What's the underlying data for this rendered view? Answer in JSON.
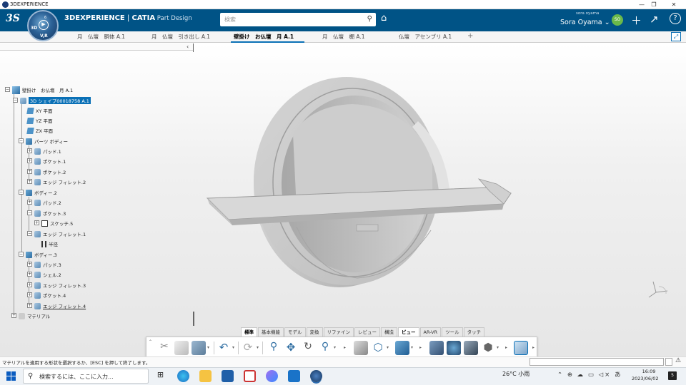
{
  "window": {
    "title": "3DEXPERIENCE",
    "minimize": "—",
    "restore": "❐",
    "close": "✕"
  },
  "header": {
    "brand": "3DEXPERIENCE",
    "separator": " | ",
    "product": "CATIA",
    "app": " Part Design",
    "compass": {
      "label_3d": "3D",
      "label_v": "V,R",
      "label_num": "6"
    },
    "search_placeholder": "検索",
    "user_small": "sora oyama",
    "user_name": "Sora Oyama ⌄",
    "avatar": "SO",
    "icons": [
      "plus-icon",
      "share-icon",
      "help-icon"
    ]
  },
  "tabs": [
    {
      "label": "月　仏壇　胴体 A.1"
    },
    {
      "label": "月　仏壇　引き出し A.1"
    },
    {
      "label": "壁掛け　お仏壇　月 A.1",
      "active": true
    },
    {
      "label": "月　仏壇　棚 A.1"
    },
    {
      "label": "仏壇　アセンブリ A.1"
    }
  ],
  "tab_add": "+",
  "tree": {
    "collapse_arrow": "‹",
    "root": "壁掛け　お仏壇　月 A.1",
    "shape": "3D シェイプ00018758 A.1",
    "planes": [
      "XY 平面",
      "YZ 平面",
      "ZX 平面"
    ],
    "part_body": "パーツ ボディー",
    "part_body_items": [
      "パッド.1",
      "ポケット.1",
      "ポケット.2",
      "エッジ フィレット.2"
    ],
    "body2": "ボディー.2",
    "body2_items": [
      "パッド.2",
      "ポケット.3"
    ],
    "body2_sketch": "スケッチ.5",
    "body2_fillet": "エッジ フィレット.1",
    "body2_fillet_child": "半径",
    "body3": "ボディー.3",
    "body3_items": [
      "パッド.3",
      "シェル.2",
      "エッジ フィレット.3",
      "ポケット.4",
      "エッジ フィレット.4"
    ],
    "material": "マテリアル"
  },
  "toolbar_tabs": [
    {
      "label": "標準",
      "active": true
    },
    {
      "label": "基本機能"
    },
    {
      "label": "モデル"
    },
    {
      "label": "変換"
    },
    {
      "label": "リファイン"
    },
    {
      "label": "レビュー"
    },
    {
      "label": "構造"
    },
    {
      "label": "ビュー",
      "active": true
    },
    {
      "label": "AR-VR"
    },
    {
      "label": "ツール"
    },
    {
      "label": "タッチ"
    }
  ],
  "status": {
    "text": "マテリアルを適用する形状を選択するか、[ESC] を押して終了します。",
    "warn": "⚠"
  },
  "taskbar": {
    "search_placeholder": "検索するには、ここに入力...",
    "weather": "26°C  小雨",
    "tray_icons": "⌃ ⊕ ☁ ▭ ◁× あ",
    "time": "16:09",
    "date": "2023/06/02",
    "notify": "5"
  },
  "colors": {
    "header": "#005386",
    "accent": "#0a70b6",
    "model": "#c8c8c8"
  }
}
